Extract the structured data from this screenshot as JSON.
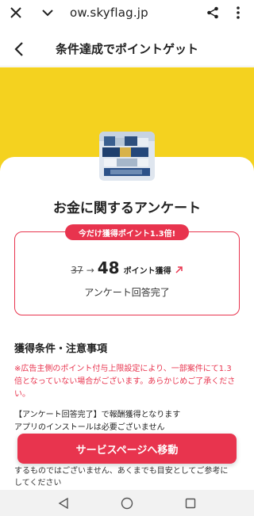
{
  "browser": {
    "url": "ow.skyflag.jp",
    "icons": [
      "close-icon",
      "chevron-down-icon",
      "share-icon",
      "more-vertical-icon"
    ]
  },
  "header": {
    "title": "条件達成でポイントゲット",
    "back_icon": "chevron-left-icon"
  },
  "colors": {
    "accent": "#e8344e",
    "hero": "#f4d21f"
  },
  "offer": {
    "title": "お金に関するアンケート",
    "banner": "今だけ獲得ポイント1.3倍!",
    "old_points": "37",
    "arrow": "→",
    "new_points": "48",
    "points_label": "ポイント獲得",
    "condition": "アンケート回答完了"
  },
  "conditions": {
    "heading": "獲得条件・注意事項",
    "notice_line1": "※広告主側のポイント付与上限設定により、一部案件にて1.3",
    "notice_line2": "倍となっていない場合がございます。あらかじめご了承くださ",
    "notice_line3": "い。",
    "body_line1": "【アンケート回答完了】で報酬獲得となります",
    "body_line2": "アプリのインストールは必要ございません",
    "tail_line1": "するものではございません、あくまでも目安としてご参考に",
    "tail_line2": "してください"
  },
  "cta": {
    "label": "サービスページへ移動"
  },
  "nav": {
    "icons": [
      "back-triangle-icon",
      "home-circle-icon",
      "recents-square-icon"
    ]
  }
}
